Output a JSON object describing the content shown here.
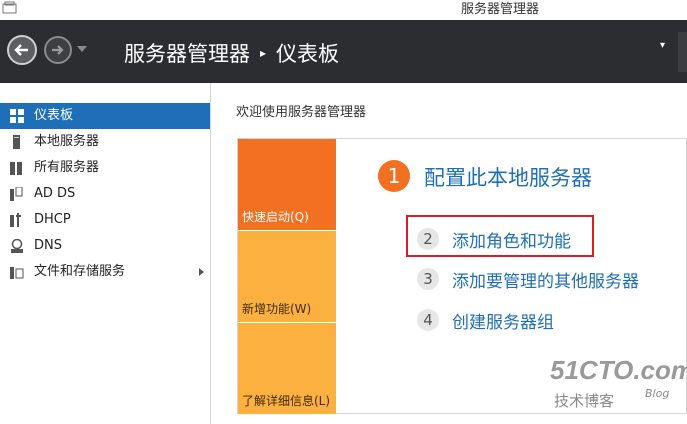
{
  "window": {
    "title": "服务器管理器"
  },
  "header": {
    "breadcrumb": {
      "root": "服务器管理器",
      "separator": "▸",
      "current": "仪表板"
    }
  },
  "sidebar": {
    "items": [
      {
        "label": "仪表板",
        "icon": "dashboard-icon",
        "active": true
      },
      {
        "label": "本地服务器",
        "icon": "server-icon"
      },
      {
        "label": "所有服务器",
        "icon": "servers-icon"
      },
      {
        "label": "AD DS",
        "icon": "adds-icon"
      },
      {
        "label": "DHCP",
        "icon": "dhcp-icon"
      },
      {
        "label": "DNS",
        "icon": "dns-icon"
      },
      {
        "label": "文件和存储服务",
        "icon": "file-storage-icon",
        "has_submenu": true
      }
    ]
  },
  "main": {
    "welcome": "欢迎使用服务器管理器",
    "tiles": [
      {
        "label": "快速启动(Q)"
      },
      {
        "label": "新增功能(W)"
      },
      {
        "label": "了解详细信息(L)"
      }
    ],
    "steps": [
      {
        "num": "1",
        "label": "配置此本地服务器"
      },
      {
        "num": "2",
        "label": "添加角色和功能"
      },
      {
        "num": "3",
        "label": "添加要管理的其他服务器"
      },
      {
        "num": "4",
        "label": "创建服务器组"
      }
    ]
  },
  "watermark": {
    "site": "51CTO.com",
    "sub": "技术博客",
    "blog": "Blog"
  },
  "colors": {
    "header_bg": "#2c2d31",
    "accent_blue": "#1f6fb8",
    "orange": "#f36f21",
    "light_orange": "#fbb040",
    "highlight_red": "#e01b22"
  }
}
